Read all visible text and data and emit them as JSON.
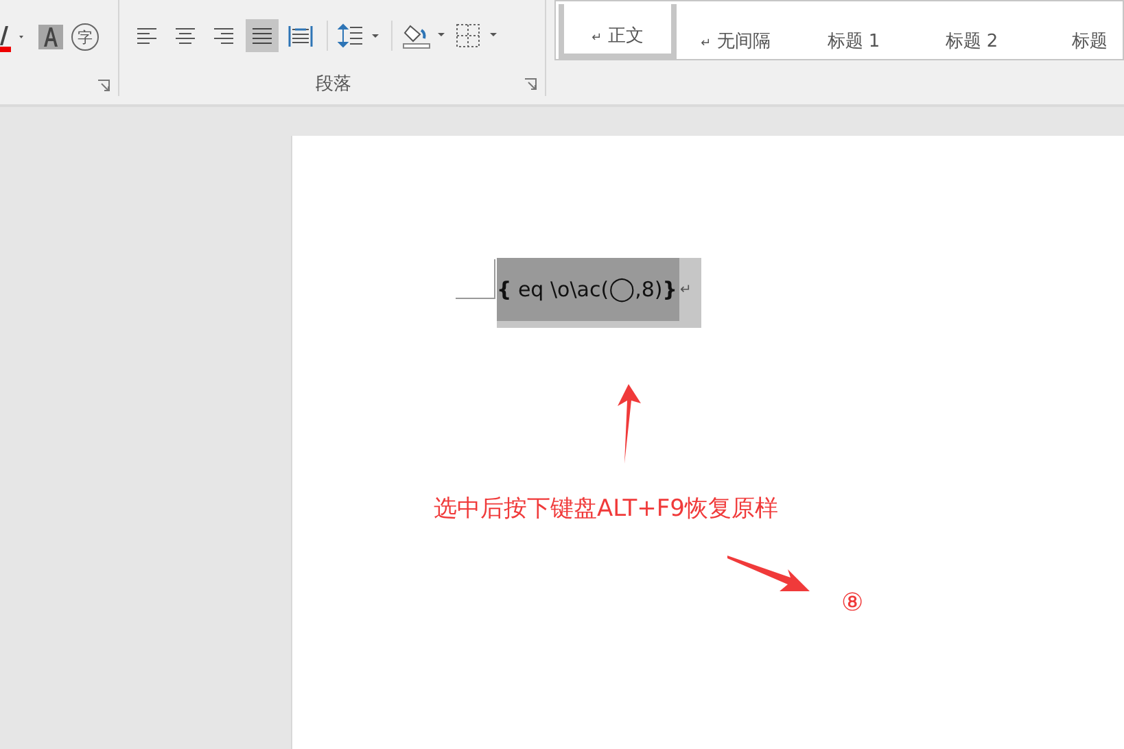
{
  "ribbon": {
    "font_tools": {
      "enclose_char": "字"
    },
    "paragraph_tools": [
      {
        "kind": "align-left",
        "selected": false
      },
      {
        "kind": "align-center",
        "selected": false
      },
      {
        "kind": "align-right",
        "selected": false
      },
      {
        "kind": "justify",
        "selected": true
      },
      {
        "kind": "distributed",
        "selected": false
      }
    ],
    "paragraph_label": "段落",
    "styles": [
      {
        "label": "正文",
        "mark": "↵",
        "selected": true
      },
      {
        "label": "无间隔",
        "mark": "↵",
        "selected": false
      },
      {
        "label": "标题 1",
        "selected": false
      },
      {
        "label": "标题 2",
        "selected": false
      },
      {
        "label": "标题",
        "selected": false
      }
    ]
  },
  "document": {
    "field_code": "**{**  eq \\o\\ac(",
    "field_circle": "◯",
    "field_tail": ",8)**}**",
    "paragraph_mark": "↵",
    "annotation": "选中后按下键盘ALT+F9恢复原样",
    "step_badge": "⑧"
  }
}
